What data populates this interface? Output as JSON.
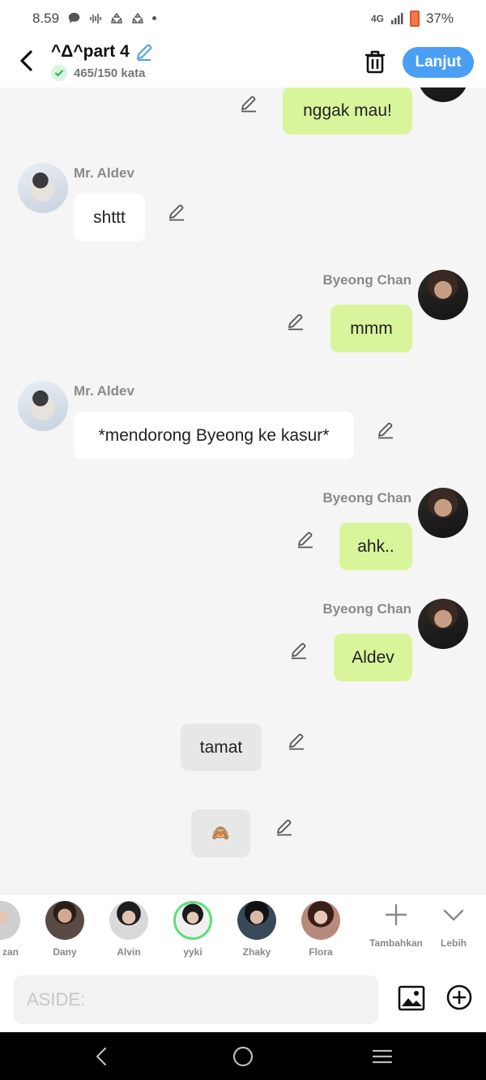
{
  "status_bar": {
    "time": "8.59",
    "network": "4G",
    "battery": "37%"
  },
  "header": {
    "title": "^Δ^part 4",
    "word_count": "465/150 kata",
    "next_label": "Lanjut"
  },
  "messages": [
    {
      "side": "right",
      "text": "nggak mau!"
    },
    {
      "side": "left",
      "sender": "Mr. Aldev",
      "text": "shttt"
    },
    {
      "side": "right",
      "sender": "Byeong Chan",
      "text": "mmm"
    },
    {
      "side": "left",
      "sender": "Mr. Aldev",
      "text": "*mendorong Byeong ke kasur*"
    },
    {
      "side": "right",
      "sender": "Byeong Chan",
      "text": "ahk.."
    },
    {
      "side": "right",
      "sender": "Byeong Chan",
      "text": "Aldev"
    },
    {
      "side": "center",
      "text": "tamat"
    },
    {
      "side": "center",
      "text": "🙈"
    }
  ],
  "characters": [
    {
      "name": "zan"
    },
    {
      "name": "Dany"
    },
    {
      "name": "Alvin"
    },
    {
      "name": "yyki"
    },
    {
      "name": "Zhaky"
    },
    {
      "name": "Flora"
    }
  ],
  "character_actions": {
    "add_label": "Tambahkan",
    "more_label": "Lebih"
  },
  "input": {
    "placeholder": "ASIDE:"
  },
  "colors": {
    "accent": "#4a9ff5",
    "bubble_self": "#d9f59c",
    "bubble_other": "#ffffff",
    "bubble_narration": "#e7e7e7"
  }
}
